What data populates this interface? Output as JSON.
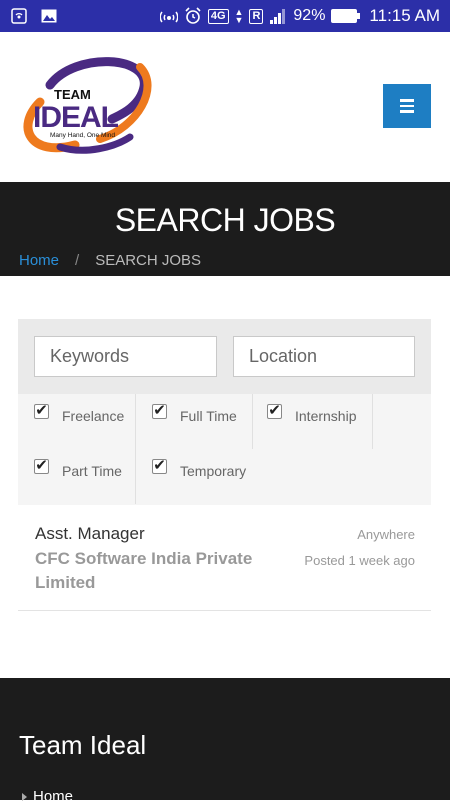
{
  "status_bar": {
    "network": "4G",
    "roaming": "R",
    "battery": "92%",
    "time": "11:15 AM"
  },
  "header": {
    "logo_text_top": "TEAM",
    "logo_text_main": "IDEAL",
    "logo_tagline": "Many Hand, One Mind"
  },
  "banner": {
    "title": "SEARCH JOBS",
    "breadcrumb_home": "Home",
    "breadcrumb_sep": "/",
    "breadcrumb_current": "SEARCH JOBS"
  },
  "search": {
    "keywords_placeholder": "Keywords",
    "location_placeholder": "Location"
  },
  "job_types": [
    {
      "label": "Freelance",
      "checked": true
    },
    {
      "label": "Full Time",
      "checked": true
    },
    {
      "label": "Internship",
      "checked": true
    },
    {
      "label": "Part Time",
      "checked": true
    },
    {
      "label": "Temporary",
      "checked": true
    }
  ],
  "jobs": [
    {
      "title": "Asst. Manager",
      "company": "CFC Software India Private Limited",
      "location": "Anywhere",
      "posted": "Posted 1 week ago"
    }
  ],
  "footer": {
    "title": "Team Ideal",
    "link_home": "Home"
  },
  "colors": {
    "status_bar": "#2c2fa8",
    "accent": "#1e7ec3",
    "dark": "#1c1c1c",
    "logo_purple": "#4a2a82",
    "logo_orange": "#ee7a1e"
  }
}
